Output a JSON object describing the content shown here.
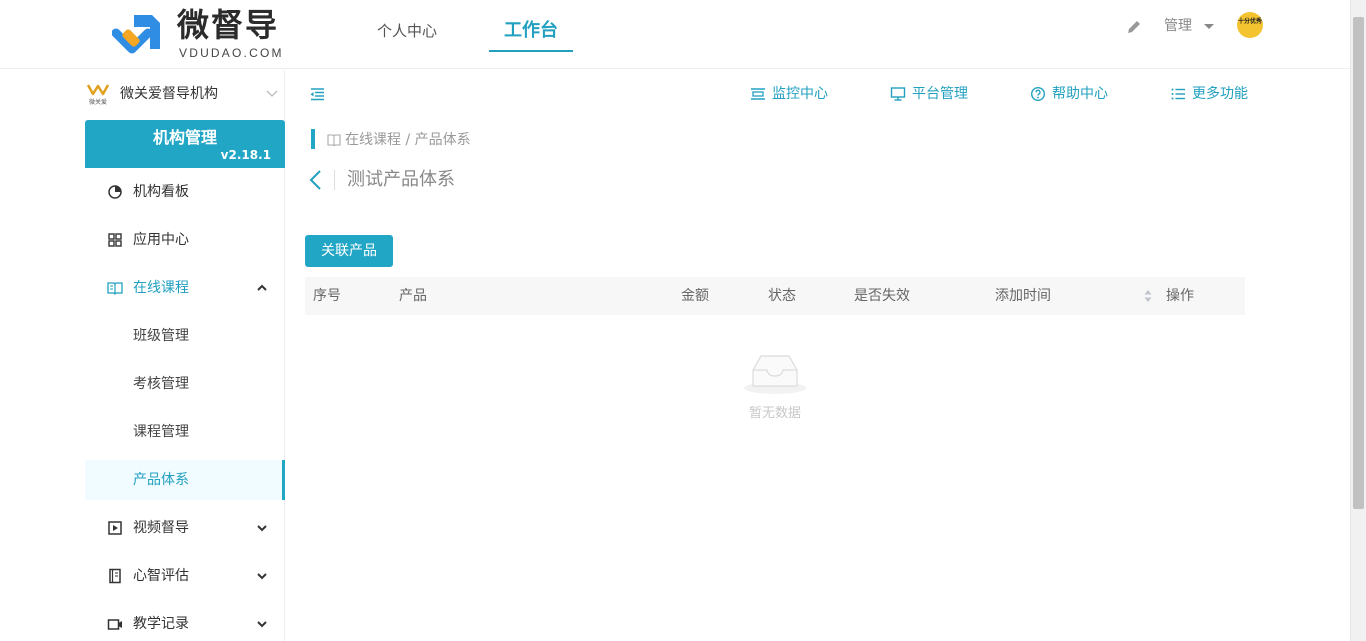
{
  "header": {
    "logo_text": "微督导",
    "logo_sub": "VDUDAO.COM",
    "nav": [
      {
        "label": "个人中心"
      },
      {
        "label": "工作台"
      }
    ],
    "admin_label": "管理",
    "avatar_text": "十分优秀"
  },
  "sidebar": {
    "org_logo_text": "微关爱",
    "org_name": "微关爱督导机构",
    "brand_title": "机构管理",
    "version": "v2.18.1",
    "items": [
      {
        "label": "机构看板"
      },
      {
        "label": "应用中心"
      },
      {
        "label": "在线课程"
      },
      {
        "label": "班级管理"
      },
      {
        "label": "考核管理"
      },
      {
        "label": "课程管理"
      },
      {
        "label": "产品体系"
      },
      {
        "label": "视频督导"
      },
      {
        "label": "心智评估"
      },
      {
        "label": "教学记录"
      }
    ]
  },
  "toolbar": {
    "links": [
      {
        "label": "监控中心",
        "icon": "monitor-list-icon"
      },
      {
        "label": "平台管理",
        "icon": "desktop-icon"
      },
      {
        "label": "帮助中心",
        "icon": "help-circle-icon"
      },
      {
        "label": "更多功能",
        "icon": "list-icon"
      }
    ]
  },
  "breadcrumb": "在线课程 / 产品体系",
  "page_title": "测试产品体系",
  "actions": {
    "link_product": "关联产品"
  },
  "table": {
    "columns": [
      "序号",
      "产品",
      "金额",
      "状态",
      "是否失效",
      "添加时间",
      "操作"
    ],
    "rows": [],
    "empty_text": "暂无数据"
  },
  "colors": {
    "accent": "#22a6c6",
    "active_bg": "#f0fcff"
  }
}
